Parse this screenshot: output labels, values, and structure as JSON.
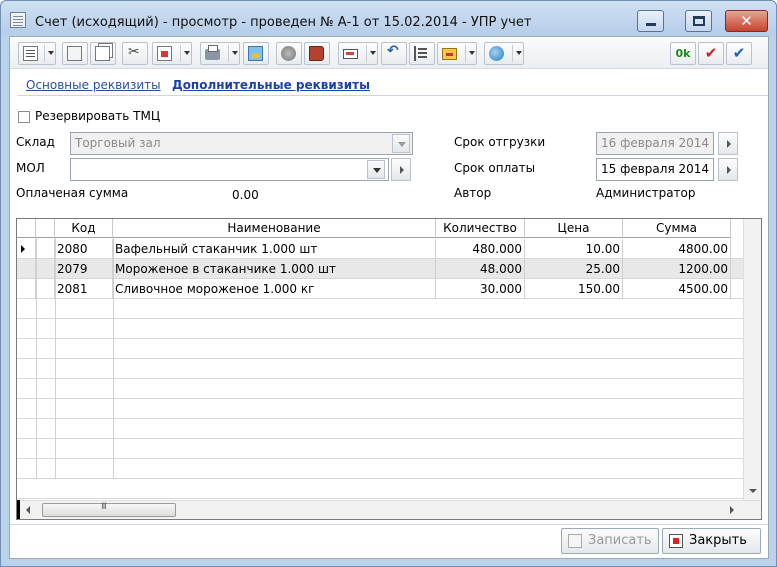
{
  "window": {
    "title": "Счет (исходящий) - просмотр - проведен № А-1 от 15.02.2014 - УПР учет",
    "minimize_glyph": "",
    "maximize_glyph": "",
    "close_glyph": "✕"
  },
  "toolbar": {
    "buttons": [
      "list-icon",
      "document-icon",
      "copy-icon",
      "scissors-icon",
      "export-icon",
      "print-icon",
      "image-icon",
      "brain-icon",
      "book-icon",
      "card-icon",
      "undo-icon",
      "structure-icon",
      "briefcase-icon",
      "globe-icon"
    ],
    "ok_label": "0k",
    "check_label": "✔",
    "check2_label": "✔"
  },
  "tabs": [
    {
      "label": "Основные реквизиты"
    },
    {
      "label": "Дополнительные реквизиты"
    }
  ],
  "form": {
    "reserve_label": "Резервировать ТМЦ",
    "reserve_checked": false,
    "warehouse_label": "Склад",
    "warehouse_value": "Торговый зал",
    "mol_label": "МОЛ",
    "mol_value": "",
    "paid_label": "Оплаченая сумма",
    "paid_value": "0.00",
    "ship_label": "Срок отгрузки",
    "ship_value": "16 февраля 2014",
    "pay_label": "Срок оплаты",
    "pay_value": "15 февраля 2014",
    "author_label": "Автор",
    "author_value": "Администратор"
  },
  "grid": {
    "headers": [
      "Код",
      "Наименование",
      "Количество",
      "Цена",
      "Сумма"
    ],
    "rows": [
      {
        "code": "2080",
        "name": "Вафельный стаканчик 1.000 шт",
        "qty": "480.000",
        "price": "10.00",
        "sum": "4800.00"
      },
      {
        "code": "2079",
        "name": "Мороженое в стаканчике 1.000 шт",
        "qty": "48.000",
        "price": "25.00",
        "sum": "1200.00"
      },
      {
        "code": "2081",
        "name": "Сливочное мороженое 1.000 кг",
        "qty": "30.000",
        "price": "150.00",
        "sum": "4500.00"
      }
    ]
  },
  "footer": {
    "save_label": "Записать",
    "close_label": "Закрыть"
  }
}
